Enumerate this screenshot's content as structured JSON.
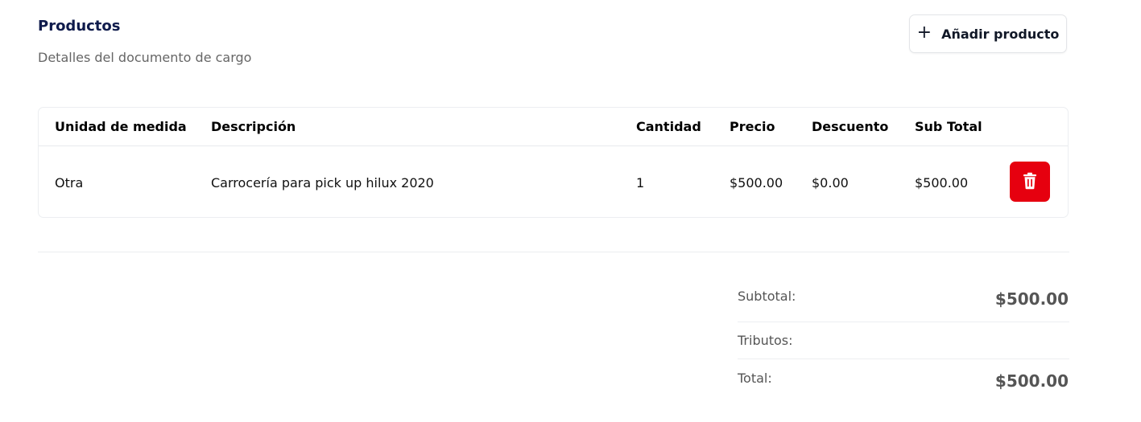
{
  "header": {
    "title": "Productos",
    "subtitle": "Detalles del documento de cargo",
    "add_button_label": "Añadir producto",
    "add_button_icon": "plus-icon"
  },
  "table": {
    "columns": [
      "Unidad de medida",
      "Descripción",
      "Cantidad",
      "Precio",
      "Descuento",
      "Sub Total"
    ],
    "rows": [
      {
        "unidad": "Otra",
        "descripcion": "Carrocería para pick up hilux 2020",
        "cantidad": "1",
        "precio": "$500.00",
        "descuento": "$0.00",
        "subtotal": "$500.00",
        "delete_icon": "trash-icon",
        "delete_color": "#e6000f"
      }
    ]
  },
  "summary": {
    "subtotal_label": "Subtotal:",
    "subtotal_value": "$500.00",
    "tributos_label": "Tributos:",
    "total_label": "Total:",
    "total_value": "$500.00"
  }
}
